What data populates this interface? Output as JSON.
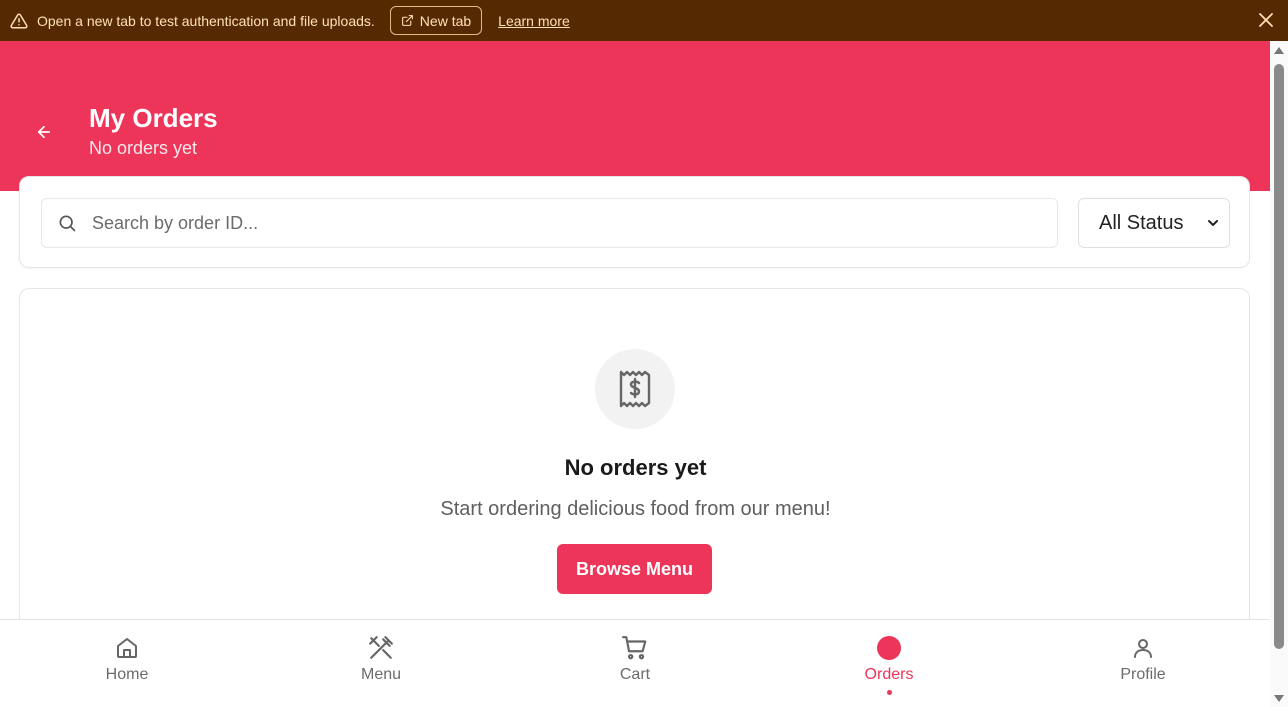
{
  "banner": {
    "message": "Open a new tab to test authentication and file uploads.",
    "new_tab_label": "New tab",
    "learn_more_label": "Learn more",
    "warning_icon": "warning-icon",
    "close_icon": "close-icon"
  },
  "header": {
    "title": "My Orders",
    "subtitle": "No orders yet",
    "back_icon": "arrow-left-icon"
  },
  "filters": {
    "search_placeholder": "Search by order ID...",
    "search_value": "",
    "status_selected": "All Status"
  },
  "empty_state": {
    "icon": "receipt-icon",
    "title": "No orders yet",
    "message": "Start ordering delicious food from our menu!",
    "button_label": "Browse Menu"
  },
  "bottom_nav": {
    "items": [
      {
        "label": "Home",
        "icon": "home-icon",
        "active": false
      },
      {
        "label": "Menu",
        "icon": "utensils-icon",
        "active": false
      },
      {
        "label": "Cart",
        "icon": "cart-icon",
        "active": false
      },
      {
        "label": "Orders",
        "icon": "orders-icon",
        "active": true
      },
      {
        "label": "Profile",
        "icon": "user-icon",
        "active": false
      }
    ]
  },
  "colors": {
    "brand": "#ed3459",
    "banner_bg": "#562a00",
    "banner_text": "#ffe0b8"
  }
}
